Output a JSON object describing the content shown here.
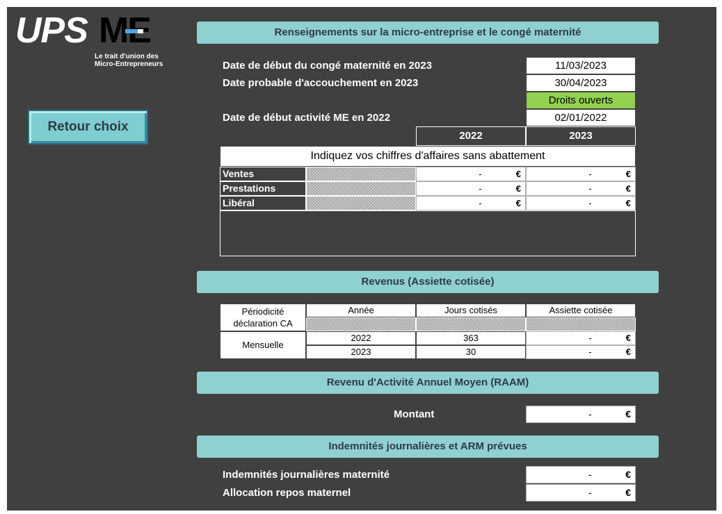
{
  "logo": {
    "ups": "UPS",
    "me": "ME",
    "tagline_line1": "Le trait d'union des",
    "tagline_line2": "Micro-Entrepreneurs"
  },
  "retour_button": "Retour choix",
  "section1": {
    "title": "Renseignements sur la micro-entreprise et le congé maternité",
    "date_debut_conge_label": "Date de début du congé maternité en 2023",
    "date_debut_conge_value": "11/03/2023",
    "date_accouchement_label": "Date probable d'accouchement en 2023",
    "date_accouchement_value": "30/04/2023",
    "droits_status": "Droits ouverts",
    "date_debut_activite_label": "Date de début activité ME en 2022",
    "date_debut_activite_value": "02/01/2022",
    "year_headers": [
      "2022",
      "2023"
    ],
    "ca_title": "Indiquez vos chiffres d'affaires sans abattement",
    "ca_rows": [
      {
        "label": "Ventes",
        "v2022": "-",
        "v2023": "-"
      },
      {
        "label": "Prestations",
        "v2022": "-",
        "v2023": "-"
      },
      {
        "label": "Libéral",
        "v2022": "-",
        "v2023": "-"
      }
    ],
    "currency": "€"
  },
  "section2": {
    "title": "Revenus (Assiette cotisée)",
    "headers": [
      "Périodicité déclaration CA",
      "Année",
      "Jours cotisés",
      "Assiette cotisée"
    ],
    "periodicite": "Mensuelle",
    "rows": [
      {
        "annee": "2022",
        "jours": "363",
        "assiette": "-"
      },
      {
        "annee": "2023",
        "jours": "30",
        "assiette": "-"
      }
    ]
  },
  "section3": {
    "title": "Revenu d'Activité Annuel Moyen (RAAM)",
    "montant_label": "Montant",
    "montant_value": "-"
  },
  "section4": {
    "title": "Indemnités journalières et ARM prévues",
    "ij_label": "Indemnités journalières maternité",
    "ij_value": "-",
    "arm_label": "Allocation repos maternel",
    "arm_value": "-"
  }
}
